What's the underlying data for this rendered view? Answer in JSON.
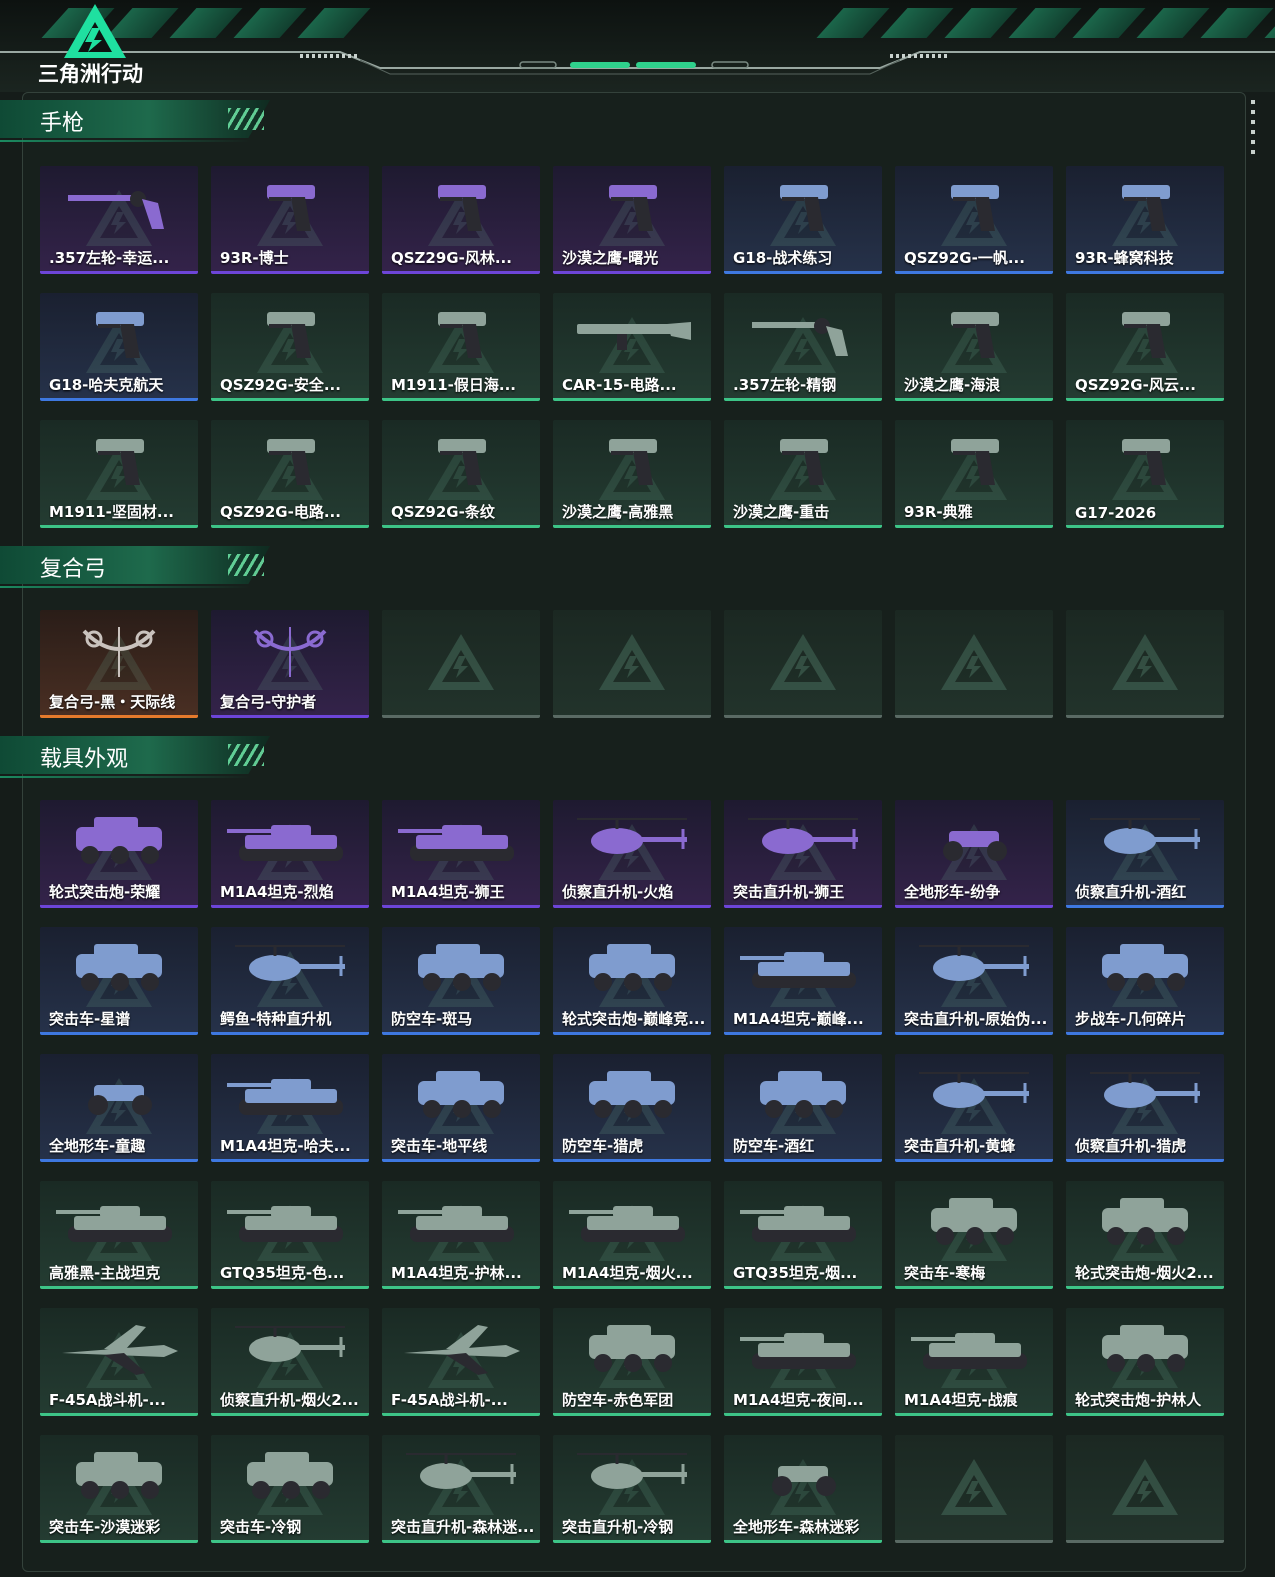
{
  "app": {
    "logo_text": "三角洲行动"
  },
  "colors": {
    "purple": "#6d45d8",
    "orange": "#e57a2c",
    "blue": "#3e78e0",
    "green": "#3dc487",
    "accent": "#1e7a58"
  },
  "sections": [
    {
      "title": "手枪",
      "items": [
        {
          "label": ".357左轮-幸运...",
          "rarity": "purple",
          "icon": "revolver-skin"
        },
        {
          "label": "93R-博士",
          "rarity": "purple",
          "icon": "pistol-skin"
        },
        {
          "label": "QSZ29G-风林...",
          "rarity": "purple",
          "icon": "pistol-skin"
        },
        {
          "label": "沙漠之鹰-曙光",
          "rarity": "purple",
          "icon": "pistol-skin"
        },
        {
          "label": "G18-战术练习",
          "rarity": "blue",
          "icon": "pistol-skin"
        },
        {
          "label": "QSZ92G-一帆...",
          "rarity": "blue",
          "icon": "pistol-skin"
        },
        {
          "label": "93R-蜂窝科技",
          "rarity": "blue",
          "icon": "pistol-skin"
        },
        {
          "label": "G18-哈夫克航天",
          "rarity": "blue",
          "icon": "pistol-skin"
        },
        {
          "label": "QSZ92G-安全...",
          "rarity": "green",
          "icon": "pistol-skin"
        },
        {
          "label": "M1911-假日海...",
          "rarity": "green",
          "icon": "pistol-skin"
        },
        {
          "label": "CAR-15-电路...",
          "rarity": "green",
          "icon": "rifle-skin"
        },
        {
          "label": ".357左轮-精钢",
          "rarity": "green",
          "icon": "revolver-skin"
        },
        {
          "label": "沙漠之鹰-海浪",
          "rarity": "green",
          "icon": "pistol-skin"
        },
        {
          "label": "QSZ92G-风云...",
          "rarity": "green",
          "icon": "pistol-skin"
        },
        {
          "label": "M1911-坚固材...",
          "rarity": "green",
          "icon": "pistol-skin"
        },
        {
          "label": "QSZ92G-电路...",
          "rarity": "green",
          "icon": "pistol-skin"
        },
        {
          "label": "QSZ92G-条纹",
          "rarity": "green",
          "icon": "pistol-skin"
        },
        {
          "label": "沙漠之鹰-高雅黑",
          "rarity": "green",
          "icon": "pistol-skin"
        },
        {
          "label": "沙漠之鹰-重击",
          "rarity": "green",
          "icon": "pistol-skin"
        },
        {
          "label": "93R-典雅",
          "rarity": "green",
          "icon": "pistol-skin"
        },
        {
          "label": "G17-2026",
          "rarity": "green",
          "icon": "pistol-skin"
        }
      ]
    },
    {
      "title": "复合弓",
      "items": [
        {
          "label": "复合弓-黑・天际线",
          "rarity": "brown",
          "icon": "bow-skin"
        },
        {
          "label": "复合弓-守护者",
          "rarity": "purple",
          "icon": "bow-skin"
        },
        {
          "label": "",
          "rarity": "empty",
          "icon": "empty-slot"
        },
        {
          "label": "",
          "rarity": "empty",
          "icon": "empty-slot"
        },
        {
          "label": "",
          "rarity": "empty",
          "icon": "empty-slot"
        },
        {
          "label": "",
          "rarity": "empty",
          "icon": "empty-slot"
        },
        {
          "label": "",
          "rarity": "empty",
          "icon": "empty-slot"
        }
      ]
    },
    {
      "title": "载具外观",
      "items": [
        {
          "label": "轮式突击炮-荣耀",
          "rarity": "purple",
          "icon": "vehicle-skin"
        },
        {
          "label": "M1A4坦克-烈焰",
          "rarity": "purple",
          "icon": "tank-skin"
        },
        {
          "label": "M1A4坦克-狮王",
          "rarity": "purple",
          "icon": "tank-skin"
        },
        {
          "label": "侦察直升机-火焰",
          "rarity": "purple",
          "icon": "helicopter-skin"
        },
        {
          "label": "突击直升机-狮王",
          "rarity": "purple",
          "icon": "helicopter-skin"
        },
        {
          "label": "全地形车-纷争",
          "rarity": "purple",
          "icon": "atv-skin"
        },
        {
          "label": "侦察直升机-酒红",
          "rarity": "blue",
          "icon": "helicopter-skin"
        },
        {
          "label": "突击车-星谱",
          "rarity": "blue",
          "icon": "vehicle-skin"
        },
        {
          "label": "鳄鱼-特种直升机",
          "rarity": "blue",
          "icon": "helicopter-skin"
        },
        {
          "label": "防空车-斑马",
          "rarity": "blue",
          "icon": "vehicle-skin"
        },
        {
          "label": "轮式突击炮-巅峰竞...",
          "rarity": "blue",
          "icon": "vehicle-skin"
        },
        {
          "label": "M1A4坦克-巅峰...",
          "rarity": "blue",
          "icon": "tank-skin"
        },
        {
          "label": "突击直升机-原始伪...",
          "rarity": "blue",
          "icon": "helicopter-skin"
        },
        {
          "label": "步战车-几何碎片",
          "rarity": "blue",
          "icon": "vehicle-skin"
        },
        {
          "label": "全地形车-童趣",
          "rarity": "blue",
          "icon": "atv-skin"
        },
        {
          "label": "M1A4坦克-哈夫...",
          "rarity": "blue",
          "icon": "tank-skin"
        },
        {
          "label": "突击车-地平线",
          "rarity": "blue",
          "icon": "vehicle-skin"
        },
        {
          "label": "防空车-猎虎",
          "rarity": "blue",
          "icon": "vehicle-skin"
        },
        {
          "label": "防空车-酒红",
          "rarity": "blue",
          "icon": "vehicle-skin"
        },
        {
          "label": "突击直升机-黄蜂",
          "rarity": "blue",
          "icon": "helicopter-skin"
        },
        {
          "label": "侦察直升机-猎虎",
          "rarity": "blue",
          "icon": "helicopter-skin"
        },
        {
          "label": "高雅黑-主战坦克",
          "rarity": "green",
          "icon": "tank-skin"
        },
        {
          "label": "GTQ35坦克-色...",
          "rarity": "green",
          "icon": "tank-skin"
        },
        {
          "label": "M1A4坦克-护林...",
          "rarity": "green",
          "icon": "tank-skin"
        },
        {
          "label": "M1A4坦克-烟火...",
          "rarity": "green",
          "icon": "tank-skin"
        },
        {
          "label": "GTQ35坦克-烟...",
          "rarity": "green",
          "icon": "tank-skin"
        },
        {
          "label": "突击车-寒梅",
          "rarity": "green",
          "icon": "vehicle-skin"
        },
        {
          "label": "轮式突击炮-烟火2...",
          "rarity": "green",
          "icon": "vehicle-skin"
        },
        {
          "label": "F-45A战斗机-...",
          "rarity": "green",
          "icon": "jet-skin"
        },
        {
          "label": "侦察直升机-烟火2...",
          "rarity": "green",
          "icon": "helicopter-skin"
        },
        {
          "label": "F-45A战斗机-...",
          "rarity": "green",
          "icon": "jet-skin"
        },
        {
          "label": "防空车-赤色军团",
          "rarity": "green",
          "icon": "vehicle-skin"
        },
        {
          "label": "M1A4坦克-夜间...",
          "rarity": "green",
          "icon": "tank-skin"
        },
        {
          "label": "M1A4坦克-战痕",
          "rarity": "green",
          "icon": "tank-skin"
        },
        {
          "label": "轮式突击炮-护林人",
          "rarity": "green",
          "icon": "vehicle-skin"
        },
        {
          "label": "突击车-沙漠迷彩",
          "rarity": "green",
          "icon": "vehicle-skin"
        },
        {
          "label": "突击车-冷钢",
          "rarity": "green",
          "icon": "vehicle-skin"
        },
        {
          "label": "突击直升机-森林迷...",
          "rarity": "green",
          "icon": "helicopter-skin"
        },
        {
          "label": "突击直升机-冷钢",
          "rarity": "green",
          "icon": "helicopter-skin"
        },
        {
          "label": "全地形车-森林迷彩",
          "rarity": "green",
          "icon": "atv-skin"
        },
        {
          "label": "",
          "rarity": "empty",
          "icon": "empty-slot"
        },
        {
          "label": "",
          "rarity": "empty",
          "icon": "empty-slot"
        }
      ]
    }
  ]
}
